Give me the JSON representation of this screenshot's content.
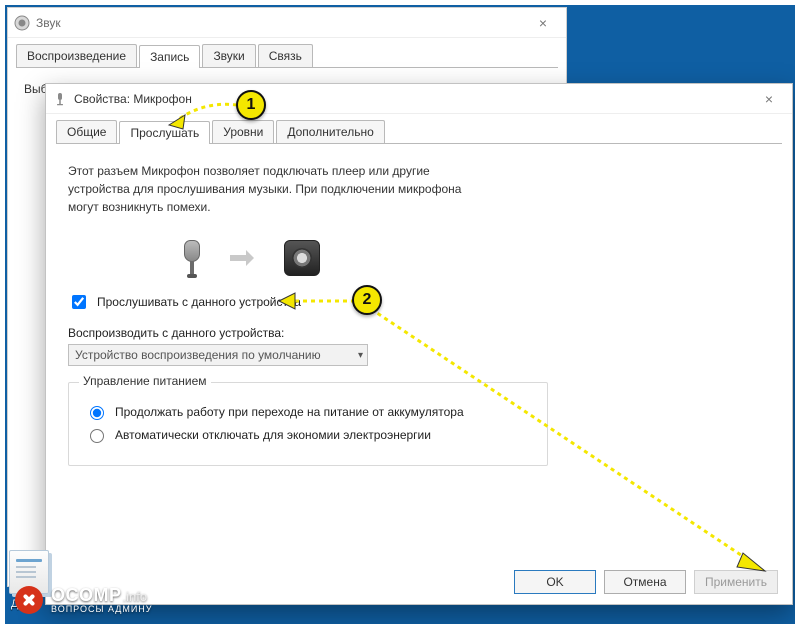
{
  "sound_window": {
    "title": "Звук",
    "close_symbol": "×",
    "tabs": [
      "Воспроизведение",
      "Запись",
      "Звуки",
      "Связь"
    ],
    "active_tab_index": 1,
    "instruction": "Выберите устройство записи, параметры которого нужно изменить:"
  },
  "props_window": {
    "title": "Свойства: Микрофон",
    "close_symbol": "×",
    "tabs": [
      "Общие",
      "Прослушать",
      "Уровни",
      "Дополнительно"
    ],
    "active_tab_index": 1,
    "description": "Этот разъем Микрофон позволяет подключать плеер или другие устройства для прослушивания музыки. При подключении микрофона могут возникнуть помехи.",
    "checkbox_label": "Прослушивать с данного устройства",
    "checkbox_checked": true,
    "play_label": "Воспроизводить с данного устройства:",
    "play_value": "Устройство воспроизведения по умолчанию",
    "power_group_title": "Управление питанием",
    "power_option_1": "Продолжать работу при переходе на питание от аккумулятора",
    "power_option_2": "Автоматически отключать для экономии электроэнергии",
    "power_selected_index": 0,
    "buttons": {
      "ok": "OK",
      "cancel": "Отмена",
      "apply": "Применить"
    }
  },
  "annotations": {
    "marker1": "1",
    "marker2": "2"
  },
  "desktop": {
    "folder_label": "Доки"
  },
  "watermark": {
    "brand": "OCOMP",
    "suffix": ".info",
    "sub": "ВОПРОСЫ АДМИНУ"
  }
}
